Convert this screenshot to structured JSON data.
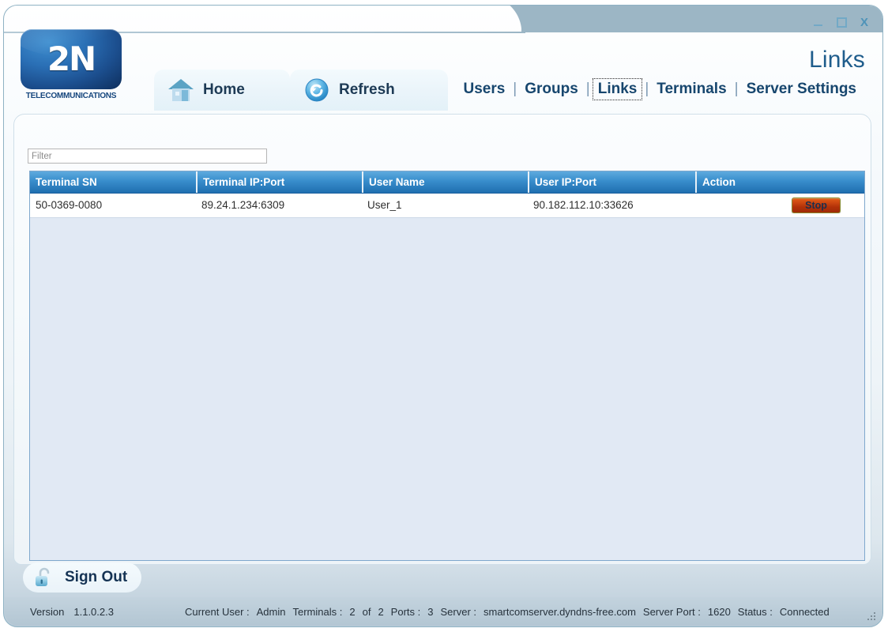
{
  "window": {
    "title": "Links",
    "controls": {
      "minimize": "minimize-icon",
      "maximize": "maximize-icon",
      "close": "X"
    }
  },
  "logo": {
    "mark": "2N",
    "subtitle": "TELECOMMUNICATIONS"
  },
  "toolbar": {
    "home_label": "Home",
    "home_icon": "home-icon",
    "refresh_label": "Refresh",
    "refresh_icon": "refresh-icon"
  },
  "nav": {
    "items": [
      {
        "label": "Users",
        "active": false
      },
      {
        "label": "Groups",
        "active": false
      },
      {
        "label": "Links",
        "active": true
      },
      {
        "label": "Terminals",
        "active": false
      },
      {
        "label": "Server Settings",
        "active": false
      }
    ],
    "separator": "|"
  },
  "filter": {
    "value": "",
    "placeholder": "Filter"
  },
  "table": {
    "columns": [
      "Terminal SN",
      "Terminal IP:Port",
      "User Name",
      "User IP:Port",
      "Action"
    ],
    "rows": [
      {
        "terminal_sn": "50-0369-0080",
        "terminal_ip_port": "89.24.1.234:6309",
        "user_name": "User_1",
        "user_ip_port": "90.182.112.10:33626",
        "action_label": "Stop"
      }
    ]
  },
  "signout": {
    "label": "Sign Out",
    "icon": "unlocked-padlock-icon"
  },
  "statusbar": {
    "version_label": "Version",
    "version_value": "1.1.0.2.3",
    "current_user_label": "Current User :",
    "current_user_value": "Admin",
    "terminals_label": "Terminals :",
    "terminals_value": "2",
    "terminals_of": "of",
    "terminals_total": "2",
    "ports_label": "Ports :",
    "ports_value": "3",
    "server_label": "Server :",
    "server_value": "smartcomserver.dyndns-free.com",
    "server_port_label": "Server Port :",
    "server_port_value": "1620",
    "status_label": "Status :",
    "status_value": "Connected"
  },
  "colors": {
    "accent": "#1f6fb0",
    "title": "#1f5d8c",
    "nav_text": "#17466e",
    "stop_button": "#b23108",
    "table_body": "#e1e9f4",
    "band": "#9cb6c5"
  }
}
